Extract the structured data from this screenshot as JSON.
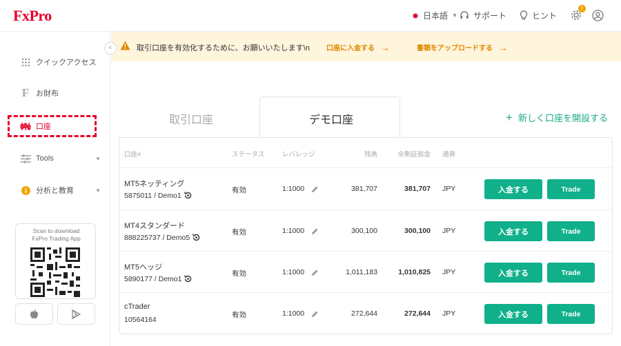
{
  "header": {
    "logo": "FxPro",
    "language": "日本語",
    "support": "サポート",
    "hint": "ヒント",
    "gear_badge": "!"
  },
  "sidebar": {
    "items": [
      {
        "label": "クイックアクセス",
        "icon": "grid-icon"
      },
      {
        "label": "お財布",
        "icon": "wallet-f-icon"
      },
      {
        "label": "口座",
        "icon": "accounts-icon"
      },
      {
        "label": "Tools",
        "icon": "sliders-icon"
      },
      {
        "label": "分析と教育",
        "icon": "info-icon"
      }
    ],
    "qr_text_line1": "Scan to download",
    "qr_text_line2": "FxPro Trading App"
  },
  "banner": {
    "message": "取引口座を有効化するために、お願いいたします\\n",
    "link1": "口座に入金する",
    "link2": "書類をアップロードする"
  },
  "tabs": {
    "trading": "取引口座",
    "demo": "デモ口座",
    "new_account": "新しく口座を開設する"
  },
  "table": {
    "headers": {
      "account": "口座#",
      "status": "ステータス",
      "leverage": "レバレッジ",
      "balance": "残高",
      "free_margin": "余剰証拠金",
      "currency": "通貨"
    },
    "rows": [
      {
        "name": "MT5ネッティング",
        "id": "5875011 / Demo1",
        "status": "有効",
        "leverage": "1:1000",
        "balance": "381,707",
        "free_margin": "381,707",
        "currency": "JPY",
        "deposit": "入金する",
        "trade": "Trade"
      },
      {
        "name": "MT4スタンダード",
        "id": "888225737 / Demo5",
        "status": "有効",
        "leverage": "1:1000",
        "balance": "300,100",
        "free_margin": "300,100",
        "currency": "JPY",
        "deposit": "入金する",
        "trade": "Trade"
      },
      {
        "name": "MT5ヘッジ",
        "id": "5890177 / Demo1",
        "status": "有効",
        "leverage": "1:1000",
        "balance": "1,011,183",
        "free_margin": "1,010,825",
        "currency": "JPY",
        "deposit": "入金する",
        "trade": "Trade"
      },
      {
        "name": "cTrader",
        "id": "10564164",
        "status": "有効",
        "leverage": "1:1000",
        "balance": "272,644",
        "free_margin": "272,644",
        "currency": "JPY",
        "deposit": "入金する",
        "trade": "Trade"
      }
    ]
  },
  "colors": {
    "brand": "#e3002a",
    "accent": "#10b08b",
    "banner_bg": "#fff4dc",
    "banner_link": "#e08a00"
  }
}
